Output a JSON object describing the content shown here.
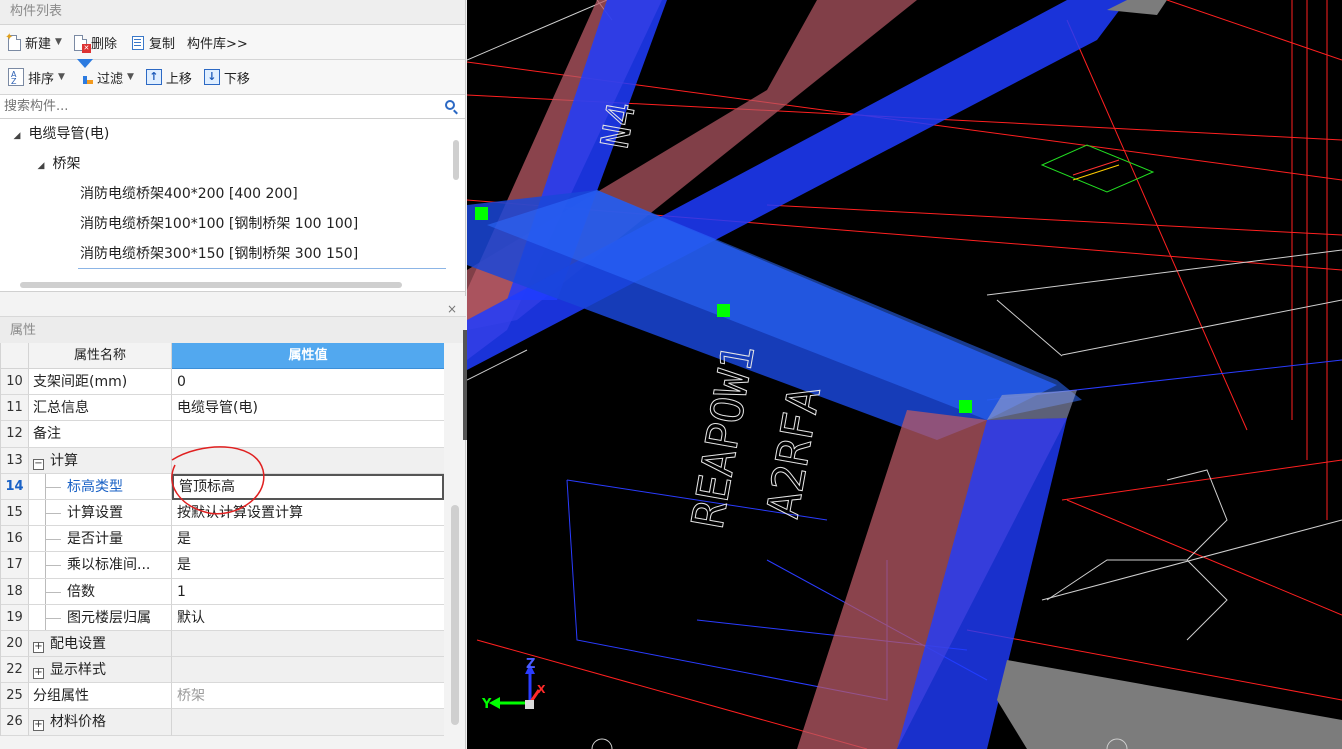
{
  "component_list": {
    "title": "构件列表",
    "toolbar1": [
      {
        "label": "新建",
        "icon": "new-icon",
        "caret": true
      },
      {
        "label": "删除",
        "icon": "delete-icon",
        "caret": false
      },
      {
        "label": "复制",
        "icon": "copy-icon",
        "caret": false
      },
      {
        "label": "构件库>>",
        "icon": "",
        "caret": false
      }
    ],
    "toolbar2": [
      {
        "label": "排序",
        "icon": "sort-icon",
        "caret": true
      },
      {
        "label": "过滤",
        "icon": "filter-icon",
        "caret": true
      },
      {
        "label": "上移",
        "icon": "move-up-icon",
        "caret": false
      },
      {
        "label": "下移",
        "icon": "move-down-icon",
        "caret": false
      }
    ],
    "search_placeholder": "搜索构件...",
    "tree": {
      "root": "电缆导管(电)",
      "group": "桥架",
      "items": [
        "消防电缆桥架400*200 [400 200]",
        "消防电缆桥架100*100 [钢制桥架 100 100]",
        "消防电缆桥架300*150 [钢制桥架 300 150]"
      ]
    }
  },
  "properties": {
    "title": "属性",
    "close": "×",
    "col_name": "属性名称",
    "col_value": "属性值",
    "rows": [
      {
        "num": "10",
        "name": "支架间距(mm)",
        "value": "0",
        "kind": "normal"
      },
      {
        "num": "11",
        "name": "汇总信息",
        "value": "电缆导管(电)",
        "kind": "normal"
      },
      {
        "num": "12",
        "name": "备注",
        "value": "",
        "kind": "normal"
      },
      {
        "num": "13",
        "name": "计算",
        "value": "",
        "kind": "group-open"
      },
      {
        "num": "14",
        "name": "标高类型",
        "value": "管顶标高",
        "kind": "child-selected"
      },
      {
        "num": "15",
        "name": "计算设置",
        "value": "按默认计算设置计算",
        "kind": "child"
      },
      {
        "num": "16",
        "name": "是否计量",
        "value": "是",
        "kind": "child"
      },
      {
        "num": "17",
        "name": "乘以标准间...",
        "value": "是",
        "kind": "child"
      },
      {
        "num": "18",
        "name": "倍数",
        "value": "1",
        "kind": "child"
      },
      {
        "num": "19",
        "name": "图元楼层归属",
        "value": "默认",
        "kind": "child"
      },
      {
        "num": "20",
        "name": "配电设置",
        "value": "",
        "kind": "group-closed"
      },
      {
        "num": "22",
        "name": "显示样式",
        "value": "",
        "kind": "group-closed"
      },
      {
        "num": "25",
        "name": "分组属性",
        "value": "桥架",
        "kind": "muted"
      },
      {
        "num": "26",
        "name": "材料价格",
        "value": "",
        "kind": "group-closed"
      }
    ]
  },
  "viewport": {
    "texts": [
      "N4",
      "REAPOW1",
      "A2RFA"
    ],
    "axis": {
      "x": "X",
      "y": "Y",
      "z": "Z"
    },
    "colors": {
      "background": "#000000",
      "tray_blue": "#1f3cff",
      "tray_red": "#b85a66",
      "grip": "#00ff00",
      "accent": "#52a8ef"
    }
  }
}
